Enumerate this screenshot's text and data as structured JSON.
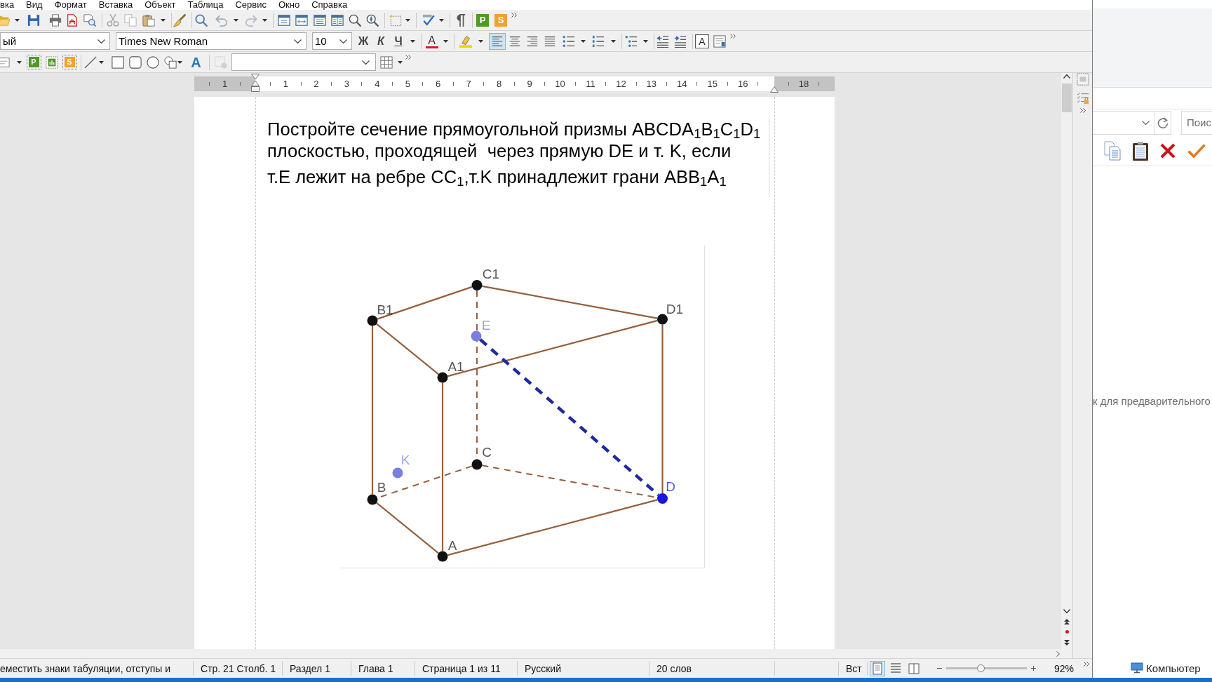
{
  "menu_bar": {
    "items": [
      "вка",
      "Вид",
      "Формат",
      "Вставка",
      "Объект",
      "Таблица",
      "Сервис",
      "Окно",
      "Справка"
    ]
  },
  "standard_toolbar": {
    "macro_buttons": [
      {
        "label": "P",
        "color": "#4f9a24"
      },
      {
        "label": "S",
        "color": "#f0a22e"
      }
    ]
  },
  "formatting_toolbar": {
    "paragraph_style": "ый",
    "font_name": "Times New Roman",
    "font_size": "10",
    "bold": "Ж",
    "italic": "К",
    "underline": "Ч",
    "font_color": {
      "label": "A",
      "color": "#d61c1c"
    },
    "alignment": [
      {
        "selected": true
      },
      {
        "selected": false
      },
      {
        "selected": false
      },
      {
        "selected": false
      }
    ],
    "text_box": "A"
  },
  "drawing_toolbar": {
    "object_tiles": [
      {
        "label": "P",
        "color": "#4f9a24"
      },
      {
        "label": "S",
        "color": "#f0a22e"
      }
    ],
    "fontwork": "A"
  },
  "ruler": {
    "numbers": [
      "1",
      "1",
      "2",
      "3",
      "4",
      "5",
      "6",
      "7",
      "8",
      "9",
      "10",
      "11",
      "12",
      "13",
      "14",
      "15",
      "16",
      "18"
    ]
  },
  "document": {
    "paragraphs": [
      {
        "lines": [
          "Постройте сечение прямоугольной призмы ABCDA$_{1}$B$_{1}$C$_{1}$D$_{1}$",
          "плоскостью, проходящей  через прямую DE и т. K, если"
        ]
      },
      {
        "lines": [
          "т.E лежит на ребре CC$_{1}$,т.K принадлежит грани ABB$_{1}$A$_{1}$"
        ]
      }
    ],
    "figure": {
      "points": [
        {
          "label": "C1",
          "color": "#111111"
        },
        {
          "label": "B1",
          "color": "#111111"
        },
        {
          "label": "D1",
          "color": "#111111"
        },
        {
          "label": "E",
          "color": "#7a80e0"
        },
        {
          "label": "A1",
          "color": "#111111"
        },
        {
          "label": "K",
          "color": "#7a80e0"
        },
        {
          "label": "C",
          "color": "#111111"
        },
        {
          "label": "B",
          "color": "#111111"
        },
        {
          "label": "D",
          "color": "#1818e0"
        },
        {
          "label": "A",
          "color": "#111111"
        }
      ]
    }
  },
  "status_bar": {
    "hint": "еместить знаки табуляции, отступы и",
    "position": "Стр. 21 Столб. 1",
    "section": "Раздел 1",
    "chapter": "Глава 1",
    "page": "Страница 1 из 11",
    "language": "Русский",
    "word_count": "20 слов",
    "insert_mode": "Вст",
    "views": [
      {
        "selected": true
      },
      {
        "selected": false
      },
      {
        "selected": false
      }
    ],
    "zoom": {
      "level": 0.43,
      "reading": "92%"
    }
  },
  "side_window": {
    "search": {
      "placeholder": "Поис"
    },
    "preview_hint": "к для предварительного",
    "location": "Компьютер"
  }
}
